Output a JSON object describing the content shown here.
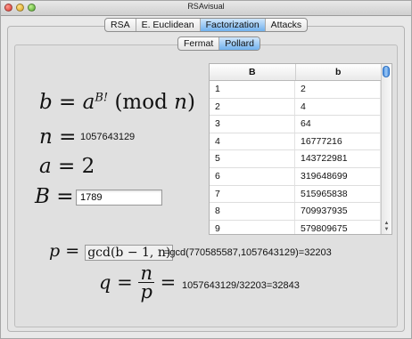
{
  "window": {
    "title": "RSAvisual"
  },
  "tabs": [
    "RSA",
    "E. Euclidean",
    "Factorization",
    "Attacks"
  ],
  "active_tab": "Factorization",
  "subtabs": [
    "Fermat",
    "Pollard"
  ],
  "active_subtab": "Pollard",
  "formulas": {
    "b_lhs": "b",
    "b_base": "a",
    "b_exp": "B!",
    "b_mod": "(mod ",
    "b_mod_var": "n",
    "b_close": ")",
    "n_var": "n",
    "n_value": "1057643129",
    "a_var": "a",
    "a_value": "2",
    "B_var": "B",
    "B_value": "1789",
    "p_var": "p",
    "p_gcd": "gcd(b − 1, n)",
    "p_result": "=gcd(770585587,1057643129)=32203",
    "q_var": "q",
    "q_num": "n",
    "q_den": "p",
    "q_result": "1057643129/32203=32843",
    "equals": "="
  },
  "table": {
    "columns": [
      "B",
      "b"
    ],
    "rows": [
      [
        "1",
        "2"
      ],
      [
        "2",
        "4"
      ],
      [
        "3",
        "64"
      ],
      [
        "4",
        "16777216"
      ],
      [
        "5",
        "143722981"
      ],
      [
        "6",
        "319648699"
      ],
      [
        "7",
        "515965838"
      ],
      [
        "8",
        "709937935"
      ],
      [
        "9",
        "579809675"
      ]
    ]
  },
  "colors": {
    "accent": "#71b1ee",
    "pane": "#e0e0e0"
  }
}
